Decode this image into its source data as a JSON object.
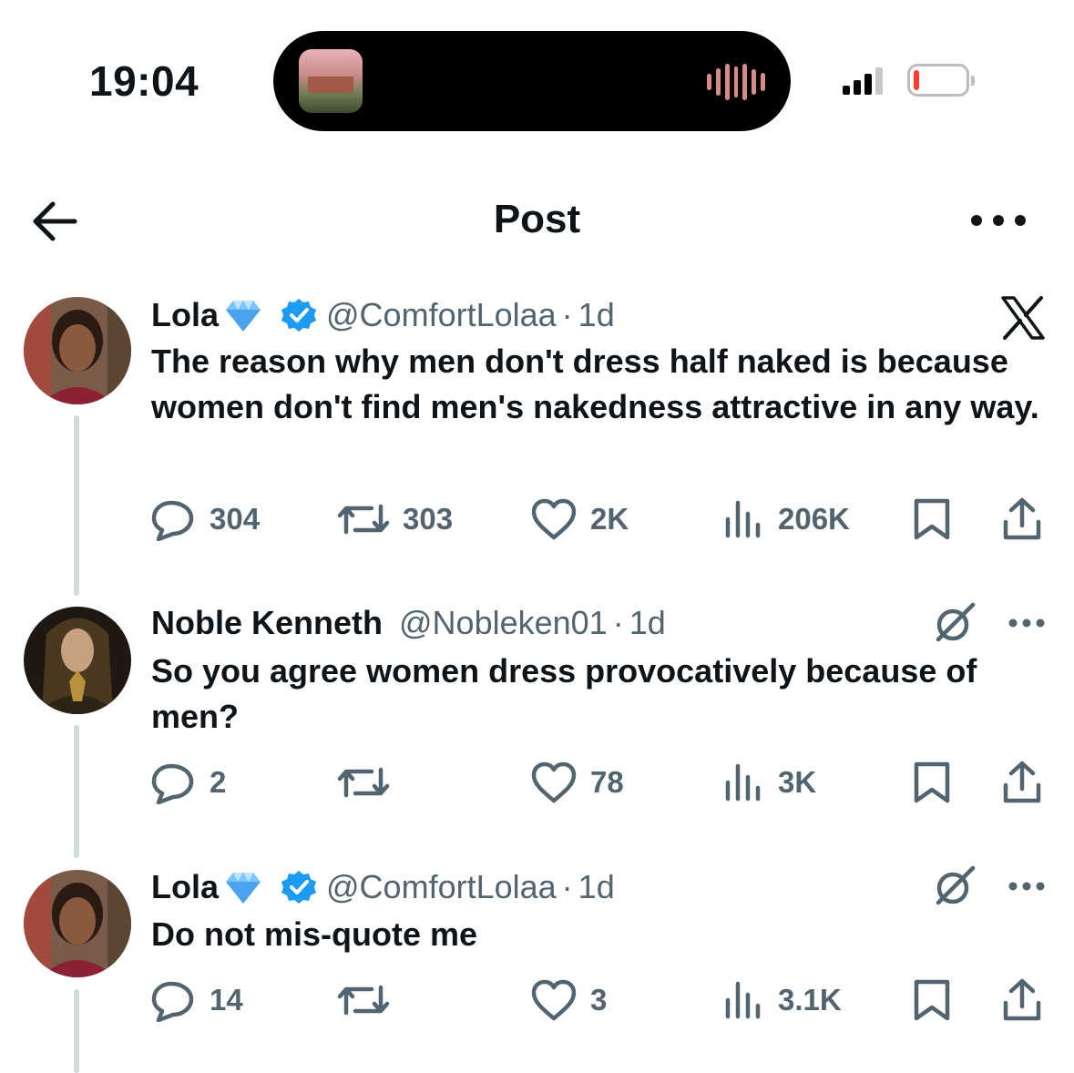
{
  "status_bar": {
    "time": "19:04",
    "battery_level_fraction": 0.1,
    "signal_bars": 3,
    "signal_bars_total": 4
  },
  "header": {
    "title": "Post",
    "back_icon": "arrow-left-icon",
    "more_icon": "more-horizontal-icon"
  },
  "tweets": [
    {
      "name": "Lola",
      "name_emoji": "diamond-emoji",
      "verified": true,
      "handle": "@ComfortLolaa",
      "separator": "·",
      "time": "1d",
      "text": "The reason why men don't dress half naked is because women don't find men's nakedness attractive in any way.",
      "replies": "304",
      "reposts": "303",
      "likes": "2K",
      "views": "206K"
    },
    {
      "name": "Noble Kenneth",
      "verified": false,
      "handle": "@Nobleken01",
      "separator": "·",
      "time": "1d",
      "text": "So you agree women dress provocatively because of men?",
      "replies": "2",
      "reposts": "",
      "likes": "78",
      "views": "3K"
    },
    {
      "name": "Lola",
      "name_emoji": "diamond-emoji",
      "verified": true,
      "handle": "@ComfortLolaa",
      "separator": "·",
      "time": "1d",
      "text": "Do not mis-quote me",
      "replies": "14",
      "reposts": "",
      "likes": "3",
      "views": "3.1K"
    }
  ],
  "colors": {
    "text": "#0f1419",
    "secondary": "#536471",
    "verified": "#1d9bf0",
    "thread_line": "#cfd9de"
  }
}
